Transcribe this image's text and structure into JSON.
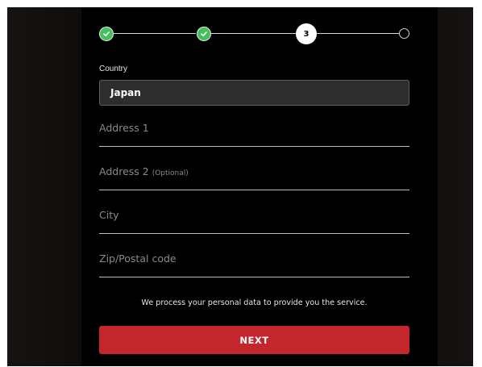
{
  "colors": {
    "accent": "#c4262e",
    "step_done": "#44c05f",
    "panel_bg": "#000000",
    "select_bg": "#2d2d2d"
  },
  "stepper": {
    "steps": [
      {
        "state": "done",
        "icon": "check-icon"
      },
      {
        "state": "done",
        "icon": "check-icon"
      },
      {
        "state": "current",
        "label": "3"
      },
      {
        "state": "todo"
      }
    ]
  },
  "form": {
    "country": {
      "label": "Country",
      "value": "Japan"
    },
    "address1": {
      "label": "Address 1"
    },
    "address2": {
      "label": "Address 2",
      "optional": "(Optional)"
    },
    "city": {
      "label": "City"
    },
    "zip": {
      "label": "Zip/Postal code"
    }
  },
  "notice": "We process your personal data to provide you the service.",
  "next_button": "NEXT"
}
